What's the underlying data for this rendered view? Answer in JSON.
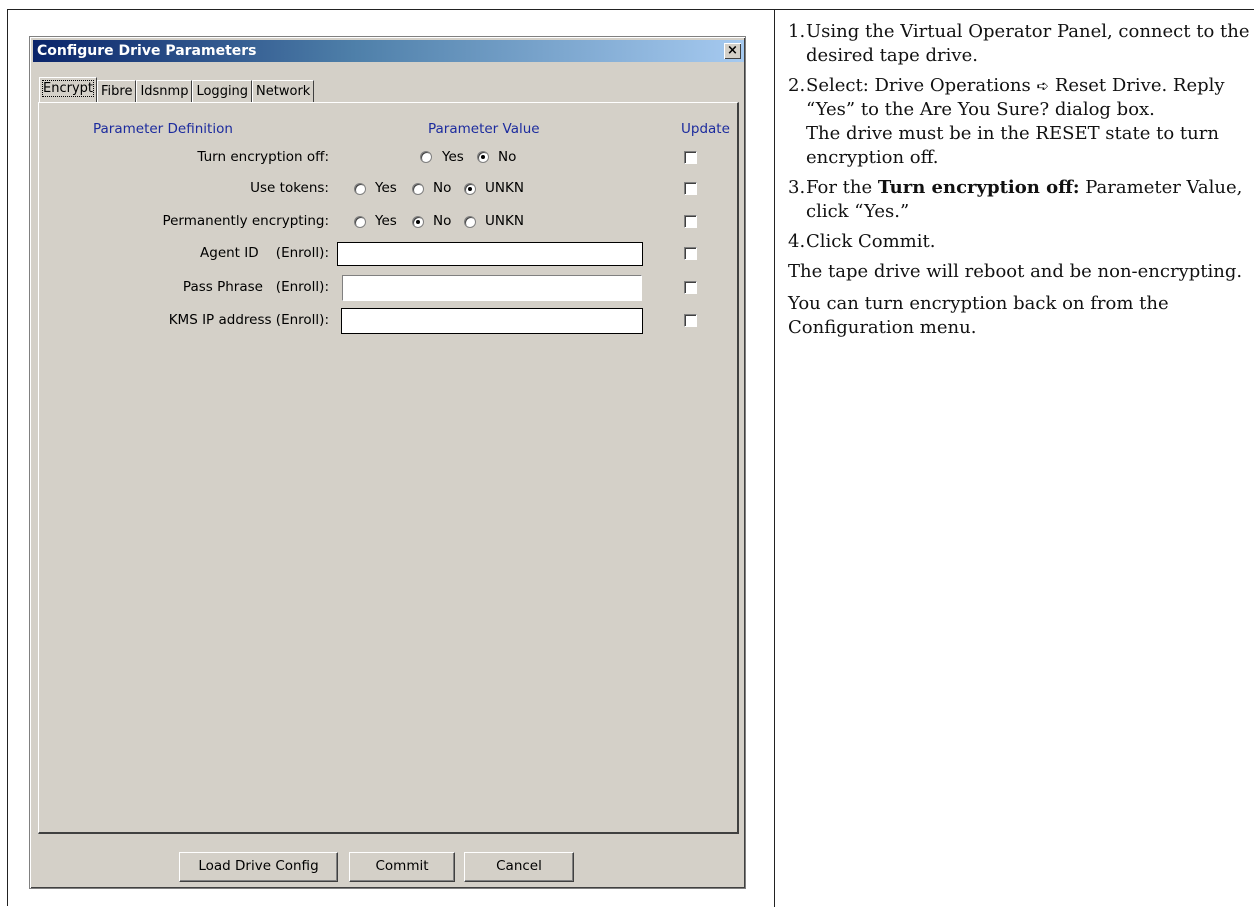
{
  "dialog": {
    "title": "Configure Drive Parameters",
    "close_label": "×",
    "tabs": [
      {
        "label": "Encrypt",
        "active": true
      },
      {
        "label": "Fibre"
      },
      {
        "label": "Idsnmp"
      },
      {
        "label": "Logging"
      },
      {
        "label": "Network"
      }
    ],
    "headers": {
      "definition": "Parameter Definition",
      "value": "Parameter Value",
      "update": "Update"
    },
    "rows": [
      {
        "label": "Turn encryption off:",
        "options": [
          "Yes",
          "No"
        ],
        "selected": "No"
      },
      {
        "label": "Use tokens:",
        "options": [
          "Yes",
          "No",
          "UNKN"
        ],
        "selected": "UNKN"
      },
      {
        "label": "Permanently encrypting:",
        "options": [
          "Yes",
          "No",
          "UNKN"
        ],
        "selected": "No"
      },
      {
        "label": "Agent ID    (Enroll):",
        "value": ""
      },
      {
        "label": "Pass Phrase   (Enroll):",
        "value": ""
      },
      {
        "label": "KMS IP address (Enroll):",
        "value": ""
      }
    ],
    "buttons": {
      "load": "Load Drive Config",
      "commit": "Commit",
      "cancel": "Cancel"
    }
  },
  "instructions": {
    "steps": [
      {
        "num": "1.",
        "text": "Using the Virtual Operator Panel, connect to the desired tape drive."
      },
      {
        "num": "2.",
        "text_a": "Select: Drive Operations",
        "arrow": "➪",
        "text_b": "Reset Drive. Reply “Yes” to the Are You Sure? dialog box.",
        "note": "The drive must be in the RESET state to turn encryption off."
      },
      {
        "num": "3.",
        "text_pre": "For the ",
        "bold": "Turn encryption off:",
        "text_post": "Parameter Value, click “Yes.”"
      },
      {
        "num": "4.",
        "text": "Click Commit."
      }
    ],
    "para1": "The tape drive will reboot and be non-encrypting.",
    "para2": "You can turn encryption back on from the Configuration menu."
  }
}
